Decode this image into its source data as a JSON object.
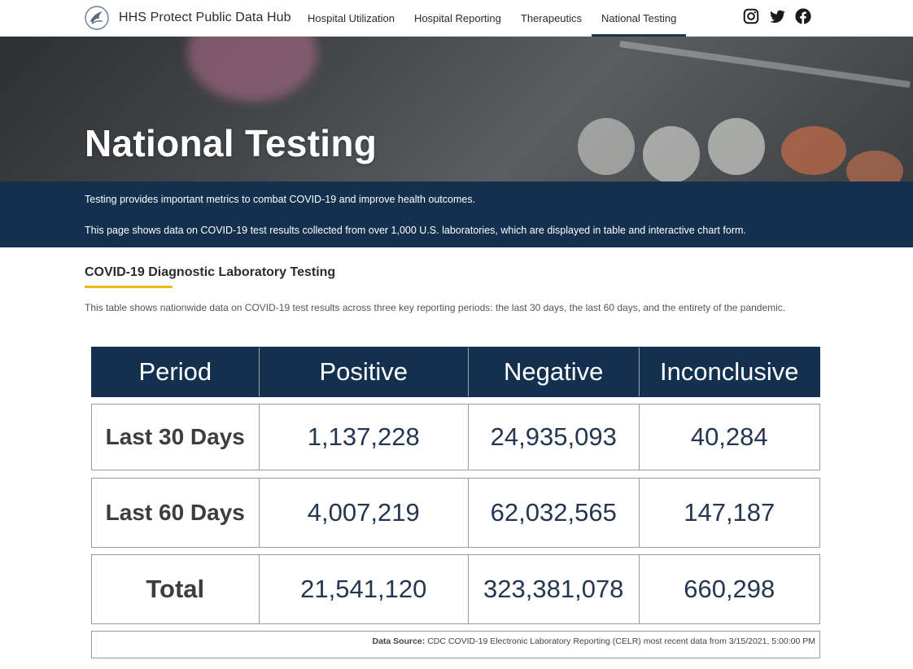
{
  "header": {
    "site_title": "HHS Protect Public Data Hub",
    "logo_icon": "hhs-eagle-logo",
    "nav": [
      {
        "label": "Hospital Utilization",
        "active": false
      },
      {
        "label": "Hospital Reporting",
        "active": false
      },
      {
        "label": "Therapeutics",
        "active": false
      },
      {
        "label": "National Testing",
        "active": true
      }
    ],
    "social_icons": [
      "instagram-icon",
      "twitter-icon",
      "facebook-icon"
    ]
  },
  "hero": {
    "title": "National Testing"
  },
  "intro": {
    "line1": "Testing provides important metrics to combat COVID-19 and improve health outcomes.",
    "line2": "This page shows data on COVID-19 test results collected from over 1,000 U.S. laboratories, which are displayed in table and interactive chart form."
  },
  "section": {
    "title": "COVID-19 Diagnostic Laboratory Testing",
    "description": "This table shows nationwide data on COVID-19 test results across three key reporting periods: the last 30 days, the last 60 days, and the entirety of the pandemic."
  },
  "table": {
    "headers": [
      "Period",
      "Positive",
      "Negative",
      "Inconclusive"
    ],
    "rows": [
      [
        "Last 30 Days",
        "1,137,228",
        "24,935,093",
        "40,284"
      ],
      [
        "Last 60 Days",
        "4,007,219",
        "62,032,565",
        "147,187"
      ],
      [
        "Total",
        "21,541,120",
        "323,381,078",
        "660,298"
      ]
    ],
    "source_label": "Data Source:",
    "source_text": "CDC COVID-19 Electronic Laboratory Reporting (CELR) most recent data from 3/15/2021, 5:00:00 PM"
  },
  "colors": {
    "navy": "#14304f",
    "accent_underline": "#f2b51a",
    "value_text": "#253650"
  }
}
